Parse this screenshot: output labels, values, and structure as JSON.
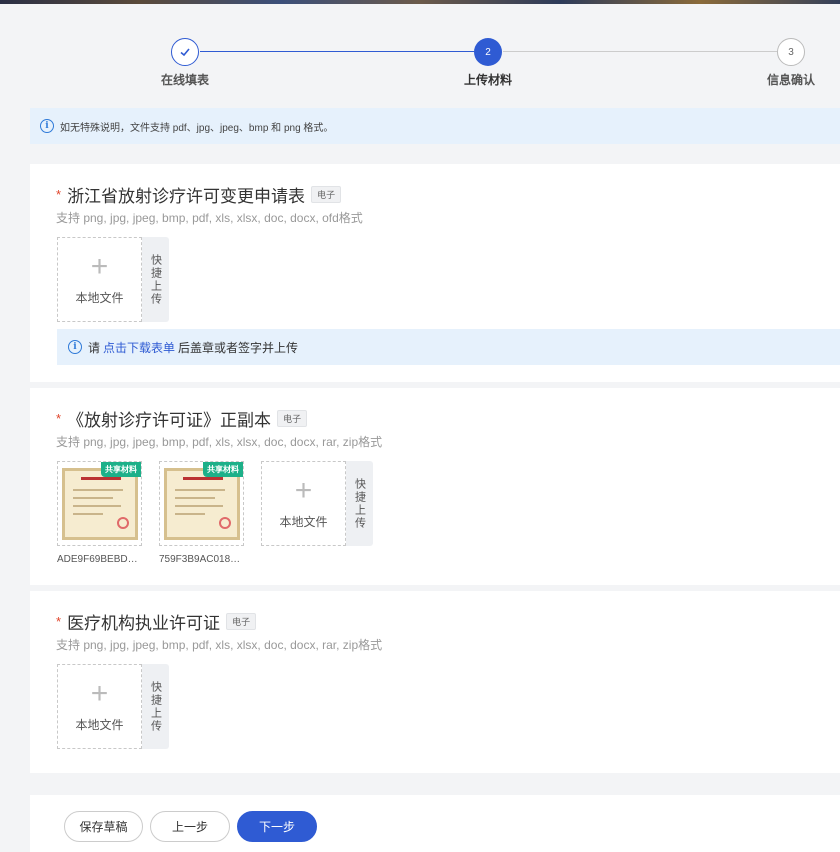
{
  "steps": [
    {
      "label": "在线填表",
      "status": "done",
      "icon": "check-icon"
    },
    {
      "label": "上传材料",
      "status": "active",
      "number": "2"
    },
    {
      "label": "信息确认",
      "status": "todo",
      "number": "3"
    }
  ],
  "notice": {
    "text": "如无特殊说明，文件支持 pdf、jpg、jpeg、bmp 和 png 格式。",
    "icon": "info-icon"
  },
  "sections": [
    {
      "title": "浙江省放射诊疗许可变更申请表",
      "tag": "电子",
      "hint": "支持 png, jpg, jpeg, bmp, pdf, xls, xlsx, doc, docx, ofd格式",
      "upload_label": "本地文件",
      "quick_label": "快捷上传",
      "download_notice": {
        "prefix": "请",
        "link": "点击下载表单",
        "suffix": "后盖章或者签字并上传"
      }
    },
    {
      "title": "《放射诊疗许可证》正副本",
      "tag": "电子",
      "hint": "支持 png, jpg, jpeg, bmp, pdf, xls, xlsx, doc, docx, rar, zip格式",
      "upload_label": "本地文件",
      "quick_label": "快捷上传",
      "files": [
        {
          "name": "ADE9F69BEBDA2...",
          "badge": "共享材料"
        },
        {
          "name": "759F3B9AC0186...",
          "badge": "共享材料"
        }
      ]
    },
    {
      "title": "医疗机构执业许可证",
      "tag": "电子",
      "hint": "支持 png, jpg, jpeg, bmp, pdf, xls, xlsx, doc, docx, rar, zip格式",
      "upload_label": "本地文件",
      "quick_label": "快捷上传"
    }
  ],
  "buttons": {
    "save": "保存草稿",
    "prev": "上一步",
    "next": "下一步"
  },
  "colors": {
    "primary": "#2f5bd3",
    "share_badge": "#1db089",
    "required": "#e0442a",
    "notice_bg": "#e6f1fc"
  }
}
